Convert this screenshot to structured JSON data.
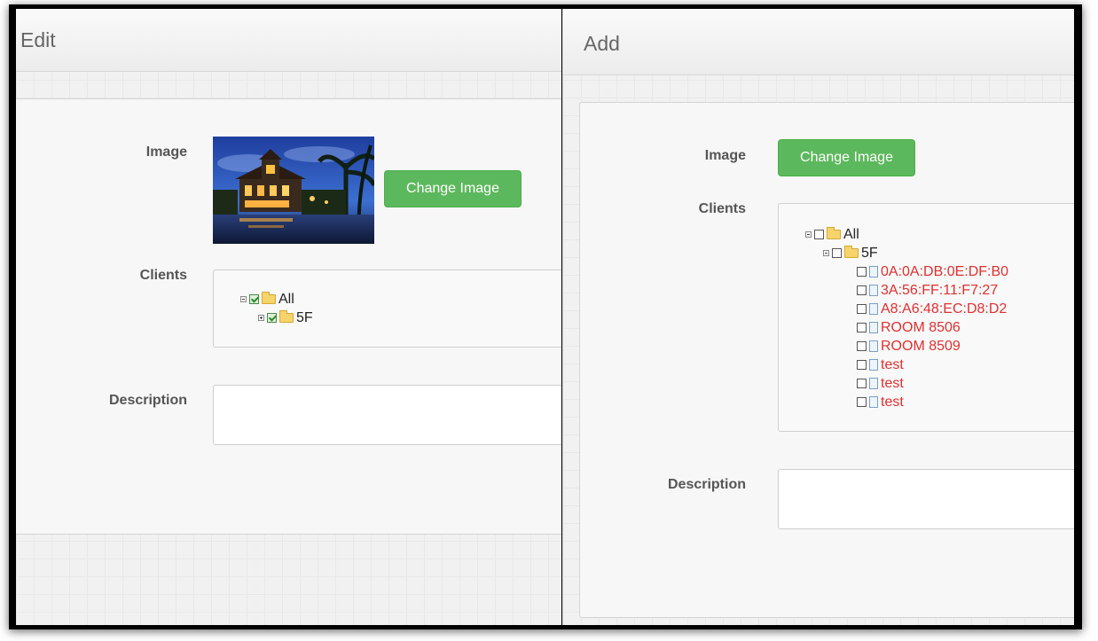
{
  "edit": {
    "title": "Edit",
    "image_label": "Image",
    "change_image": "Change Image",
    "clients_label": "Clients",
    "description_label": "Description",
    "tree": {
      "all": "All",
      "floor": "5F"
    }
  },
  "add": {
    "title": "Add",
    "image_label": "Image",
    "change_image": "Change Image",
    "clients_label": "Clients",
    "description_label": "Description",
    "tree": {
      "all": "All",
      "floor": "5F",
      "clients": [
        "0A:0A:DB:0E:DF:B0",
        "3A:56:FF:11:F7:27",
        "A8:A6:48:EC:D8:D2",
        "ROOM 8506",
        "ROOM 8509",
        "test",
        "test",
        "test"
      ]
    }
  },
  "colors": {
    "button": "#5cb85c",
    "client_text": "#e03030"
  }
}
